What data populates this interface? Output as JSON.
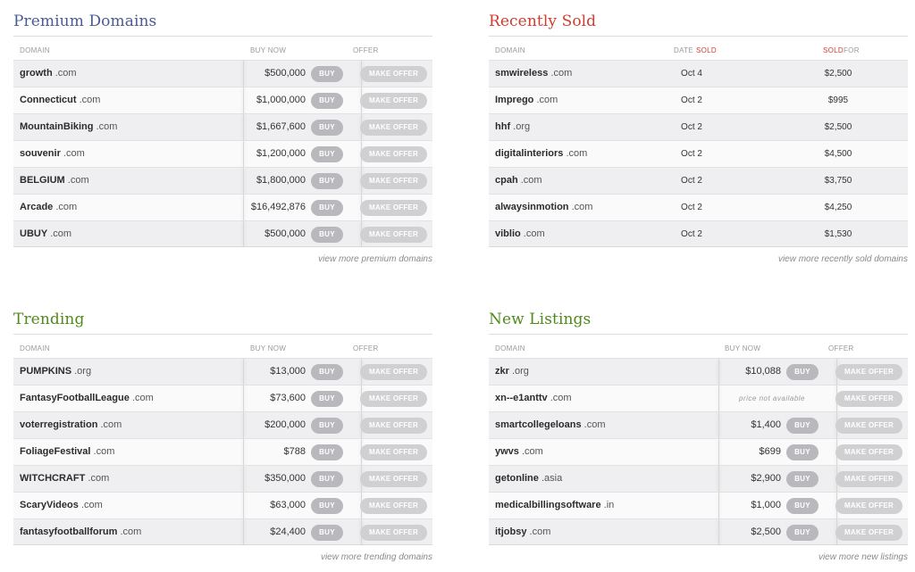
{
  "premium": {
    "title": "Premium Domains",
    "headers": {
      "domain": "DOMAIN",
      "buy_now": "BUY NOW",
      "offer": "OFFER"
    },
    "rows": [
      {
        "name": "growth",
        "tld": ".com",
        "price": "$500,000"
      },
      {
        "name": "Connecticut",
        "tld": ".com",
        "price": "$1,000,000"
      },
      {
        "name": "MountainBiking",
        "tld": ".com",
        "price": "$1,667,600"
      },
      {
        "name": "souvenir",
        "tld": ".com",
        "price": "$1,200,000"
      },
      {
        "name": "BELGIUM",
        "tld": ".com",
        "price": "$1,800,000"
      },
      {
        "name": "Arcade",
        "tld": ".com",
        "price": "$16,492,876"
      },
      {
        "name": "UBUY",
        "tld": ".com",
        "price": "$500,000"
      }
    ],
    "buy_label": "BUY",
    "offer_label": "MAKE OFFER",
    "more": "view more premium domains"
  },
  "recent": {
    "title": "Recently Sold",
    "headers": {
      "domain": "DOMAIN",
      "date": "DATE",
      "date_sold": "SOLD",
      "sold": "SOLD",
      "sold_for": "FOR"
    },
    "rows": [
      {
        "name": "smwireless",
        "tld": ".com",
        "date": "Oct 4",
        "sold_for": "$2,500"
      },
      {
        "name": "Imprego",
        "tld": ".com",
        "date": "Oct 2",
        "sold_for": "$995"
      },
      {
        "name": "hhf",
        "tld": ".org",
        "date": "Oct 2",
        "sold_for": "$2,500"
      },
      {
        "name": "digitalinteriors",
        "tld": ".com",
        "date": "Oct 2",
        "sold_for": "$4,500"
      },
      {
        "name": "cpah",
        "tld": ".com",
        "date": "Oct 2",
        "sold_for": "$3,750"
      },
      {
        "name": "alwaysinmotion",
        "tld": ".com",
        "date": "Oct 2",
        "sold_for": "$4,250"
      },
      {
        "name": "viblio",
        "tld": ".com",
        "date": "Oct 2",
        "sold_for": "$1,530"
      }
    ],
    "more": "view more recently sold domains"
  },
  "trending": {
    "title": "Trending",
    "headers": {
      "domain": "DOMAIN",
      "buy_now": "BUY NOW",
      "offer": "OFFER"
    },
    "rows": [
      {
        "name": "PUMPKINS",
        "tld": ".org",
        "price": "$13,000"
      },
      {
        "name": "FantasyFootballLeague",
        "tld": ".com",
        "price": "$73,600"
      },
      {
        "name": "voterregistration",
        "tld": ".com",
        "price": "$200,000"
      },
      {
        "name": "FoliageFestival",
        "tld": ".com",
        "price": "$788"
      },
      {
        "name": "WITCHCRAFT",
        "tld": ".com",
        "price": "$350,000"
      },
      {
        "name": "ScaryVideos",
        "tld": ".com",
        "price": "$63,000"
      },
      {
        "name": "fantasyfootballforum",
        "tld": ".com",
        "price": "$24,400"
      }
    ],
    "buy_label": "BUY",
    "offer_label": "MAKE OFFER",
    "more": "view more trending domains"
  },
  "newlist": {
    "title": "New Listings",
    "headers": {
      "domain": "DOMAIN",
      "buy_now": "BUY NOW",
      "offer": "OFFER"
    },
    "rows": [
      {
        "name": "zkr",
        "tld": ".org",
        "price": "$10,088"
      },
      {
        "name": "xn--e1anttv",
        "tld": ".com",
        "price": "",
        "na": "price not available"
      },
      {
        "name": "smartcollegeloans",
        "tld": ".com",
        "price": "$1,400"
      },
      {
        "name": "ywvs",
        "tld": ".com",
        "price": "$699"
      },
      {
        "name": "getonline",
        "tld": ".asia",
        "price": "$2,900"
      },
      {
        "name": "medicalbillingsoftware",
        "tld": ".in",
        "price": "$1,000"
      },
      {
        "name": "itjobsy",
        "tld": ".com",
        "price": "$2,500"
      }
    ],
    "buy_label": "BUY",
    "offer_label": "MAKE OFFER",
    "more": "view more new listings"
  }
}
